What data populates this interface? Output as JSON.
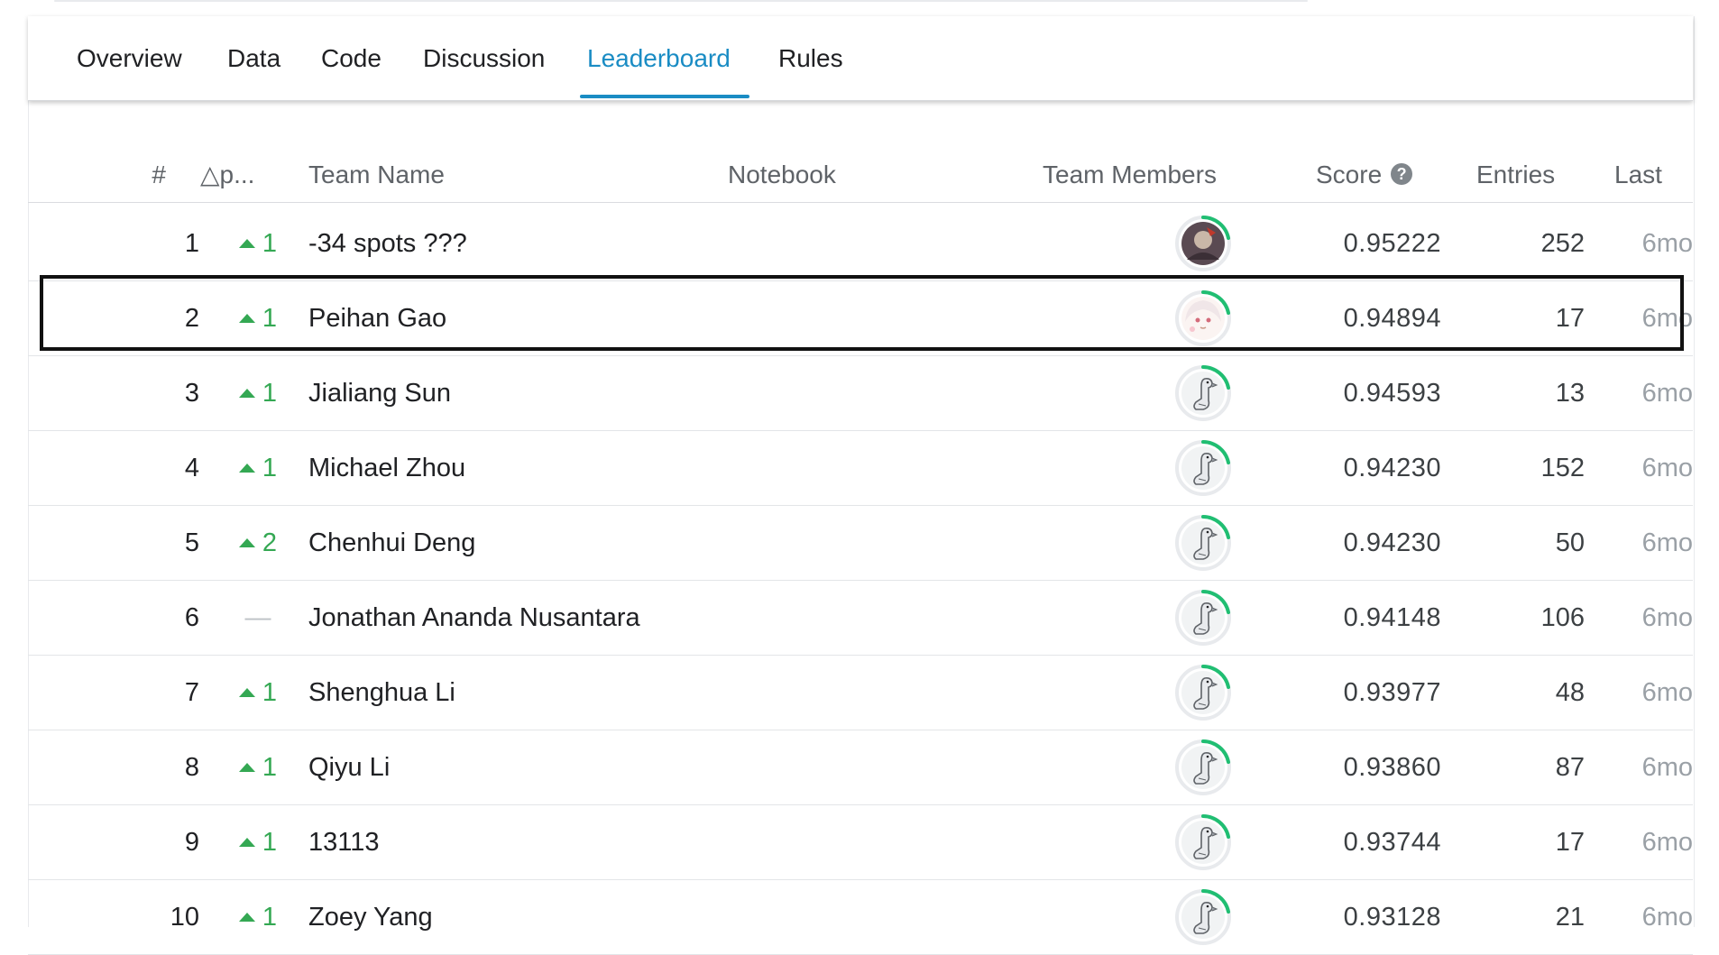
{
  "tabs": [
    {
      "label": "Overview"
    },
    {
      "label": "Data"
    },
    {
      "label": "Code"
    },
    {
      "label": "Discussion"
    },
    {
      "label": "Leaderboard",
      "active": true
    },
    {
      "label": "Rules"
    }
  ],
  "columns": {
    "rank": "#",
    "delta": "△p...",
    "team_name": "Team Name",
    "notebook": "Notebook",
    "team_members": "Team Members",
    "score": "Score",
    "entries": "Entries",
    "last": "Last"
  },
  "colors": {
    "accent": "#1a8cc4",
    "up": "#34a853",
    "avatar_ring": "#20be72"
  },
  "rows": [
    {
      "rank": "1",
      "delta": "1",
      "delta_dir": "up",
      "team": "-34 spots ???",
      "avatar": "photo-avatar",
      "score": "0.95222",
      "entries": "252",
      "last": "6mo"
    },
    {
      "rank": "2",
      "delta": "1",
      "delta_dir": "up",
      "team": "Peihan Gao",
      "avatar": "anime-avatar",
      "score": "0.94894",
      "entries": "17",
      "last": "6mo",
      "highlighted": true
    },
    {
      "rank": "3",
      "delta": "1",
      "delta_dir": "up",
      "team": "Jialiang Sun",
      "avatar": "goose-avatar",
      "score": "0.94593",
      "entries": "13",
      "last": "6mo"
    },
    {
      "rank": "4",
      "delta": "1",
      "delta_dir": "up",
      "team": "Michael Zhou",
      "avatar": "goose-avatar",
      "score": "0.94230",
      "entries": "152",
      "last": "6mo"
    },
    {
      "rank": "5",
      "delta": "2",
      "delta_dir": "up",
      "team": "Chenhui Deng",
      "avatar": "goose-avatar",
      "score": "0.94230",
      "entries": "50",
      "last": "6mo"
    },
    {
      "rank": "6",
      "delta": "—",
      "delta_dir": "none",
      "team": "Jonathan Ananda Nusantara",
      "avatar": "goose-avatar",
      "score": "0.94148",
      "entries": "106",
      "last": "6mo"
    },
    {
      "rank": "7",
      "delta": "1",
      "delta_dir": "up",
      "team": "Shenghua Li",
      "avatar": "goose-avatar",
      "score": "0.93977",
      "entries": "48",
      "last": "6mo"
    },
    {
      "rank": "8",
      "delta": "1",
      "delta_dir": "up",
      "team": "Qiyu Li",
      "avatar": "goose-avatar",
      "score": "0.93860",
      "entries": "87",
      "last": "6mo"
    },
    {
      "rank": "9",
      "delta": "1",
      "delta_dir": "up",
      "team": "13113",
      "avatar": "goose-avatar",
      "score": "0.93744",
      "entries": "17",
      "last": "6mo"
    },
    {
      "rank": "10",
      "delta": "1",
      "delta_dir": "up",
      "team": "Zoey Yang",
      "avatar": "goose-avatar",
      "score": "0.93128",
      "entries": "21",
      "last": "6mo"
    }
  ]
}
